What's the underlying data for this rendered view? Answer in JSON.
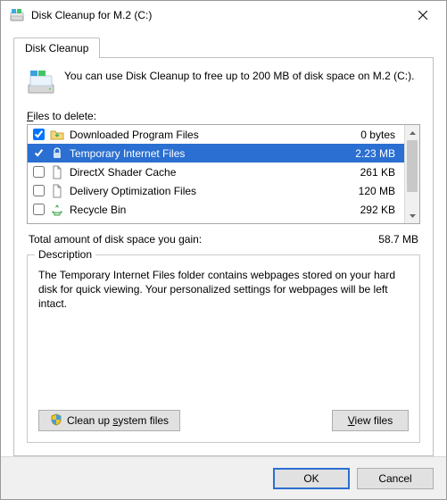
{
  "window": {
    "title": "Disk Cleanup for M.2 (C:)"
  },
  "tab": {
    "label": "Disk Cleanup"
  },
  "intro": {
    "text": "You can use Disk Cleanup to free up to 200 MB of disk space on M.2 (C:)."
  },
  "files_label_prefix": "F",
  "files_label_rest": "iles to delete:",
  "items": [
    {
      "checked": true,
      "icon": "folder-download",
      "name": "Downloaded Program Files",
      "size": "0 bytes"
    },
    {
      "checked": true,
      "icon": "lock",
      "name": "Temporary Internet Files",
      "size": "2.23 MB",
      "selected": true
    },
    {
      "checked": false,
      "icon": "file",
      "name": "DirectX Shader Cache",
      "size": "261 KB"
    },
    {
      "checked": false,
      "icon": "file",
      "name": "Delivery Optimization Files",
      "size": "120 MB"
    },
    {
      "checked": false,
      "icon": "recycle",
      "name": "Recycle Bin",
      "size": "292 KB"
    }
  ],
  "total": {
    "label": "Total amount of disk space you gain:",
    "value": "58.7 MB"
  },
  "description": {
    "legend": "Description",
    "text": "The Temporary Internet Files folder contains webpages stored on your hard disk for quick viewing. Your personalized settings for webpages will be left intact."
  },
  "buttons": {
    "cleanup_prefix": "Clean up ",
    "cleanup_u": "s",
    "cleanup_rest": "ystem files",
    "viewfiles_u": "V",
    "viewfiles_rest": "iew files",
    "ok": "OK",
    "cancel": "Cancel"
  }
}
